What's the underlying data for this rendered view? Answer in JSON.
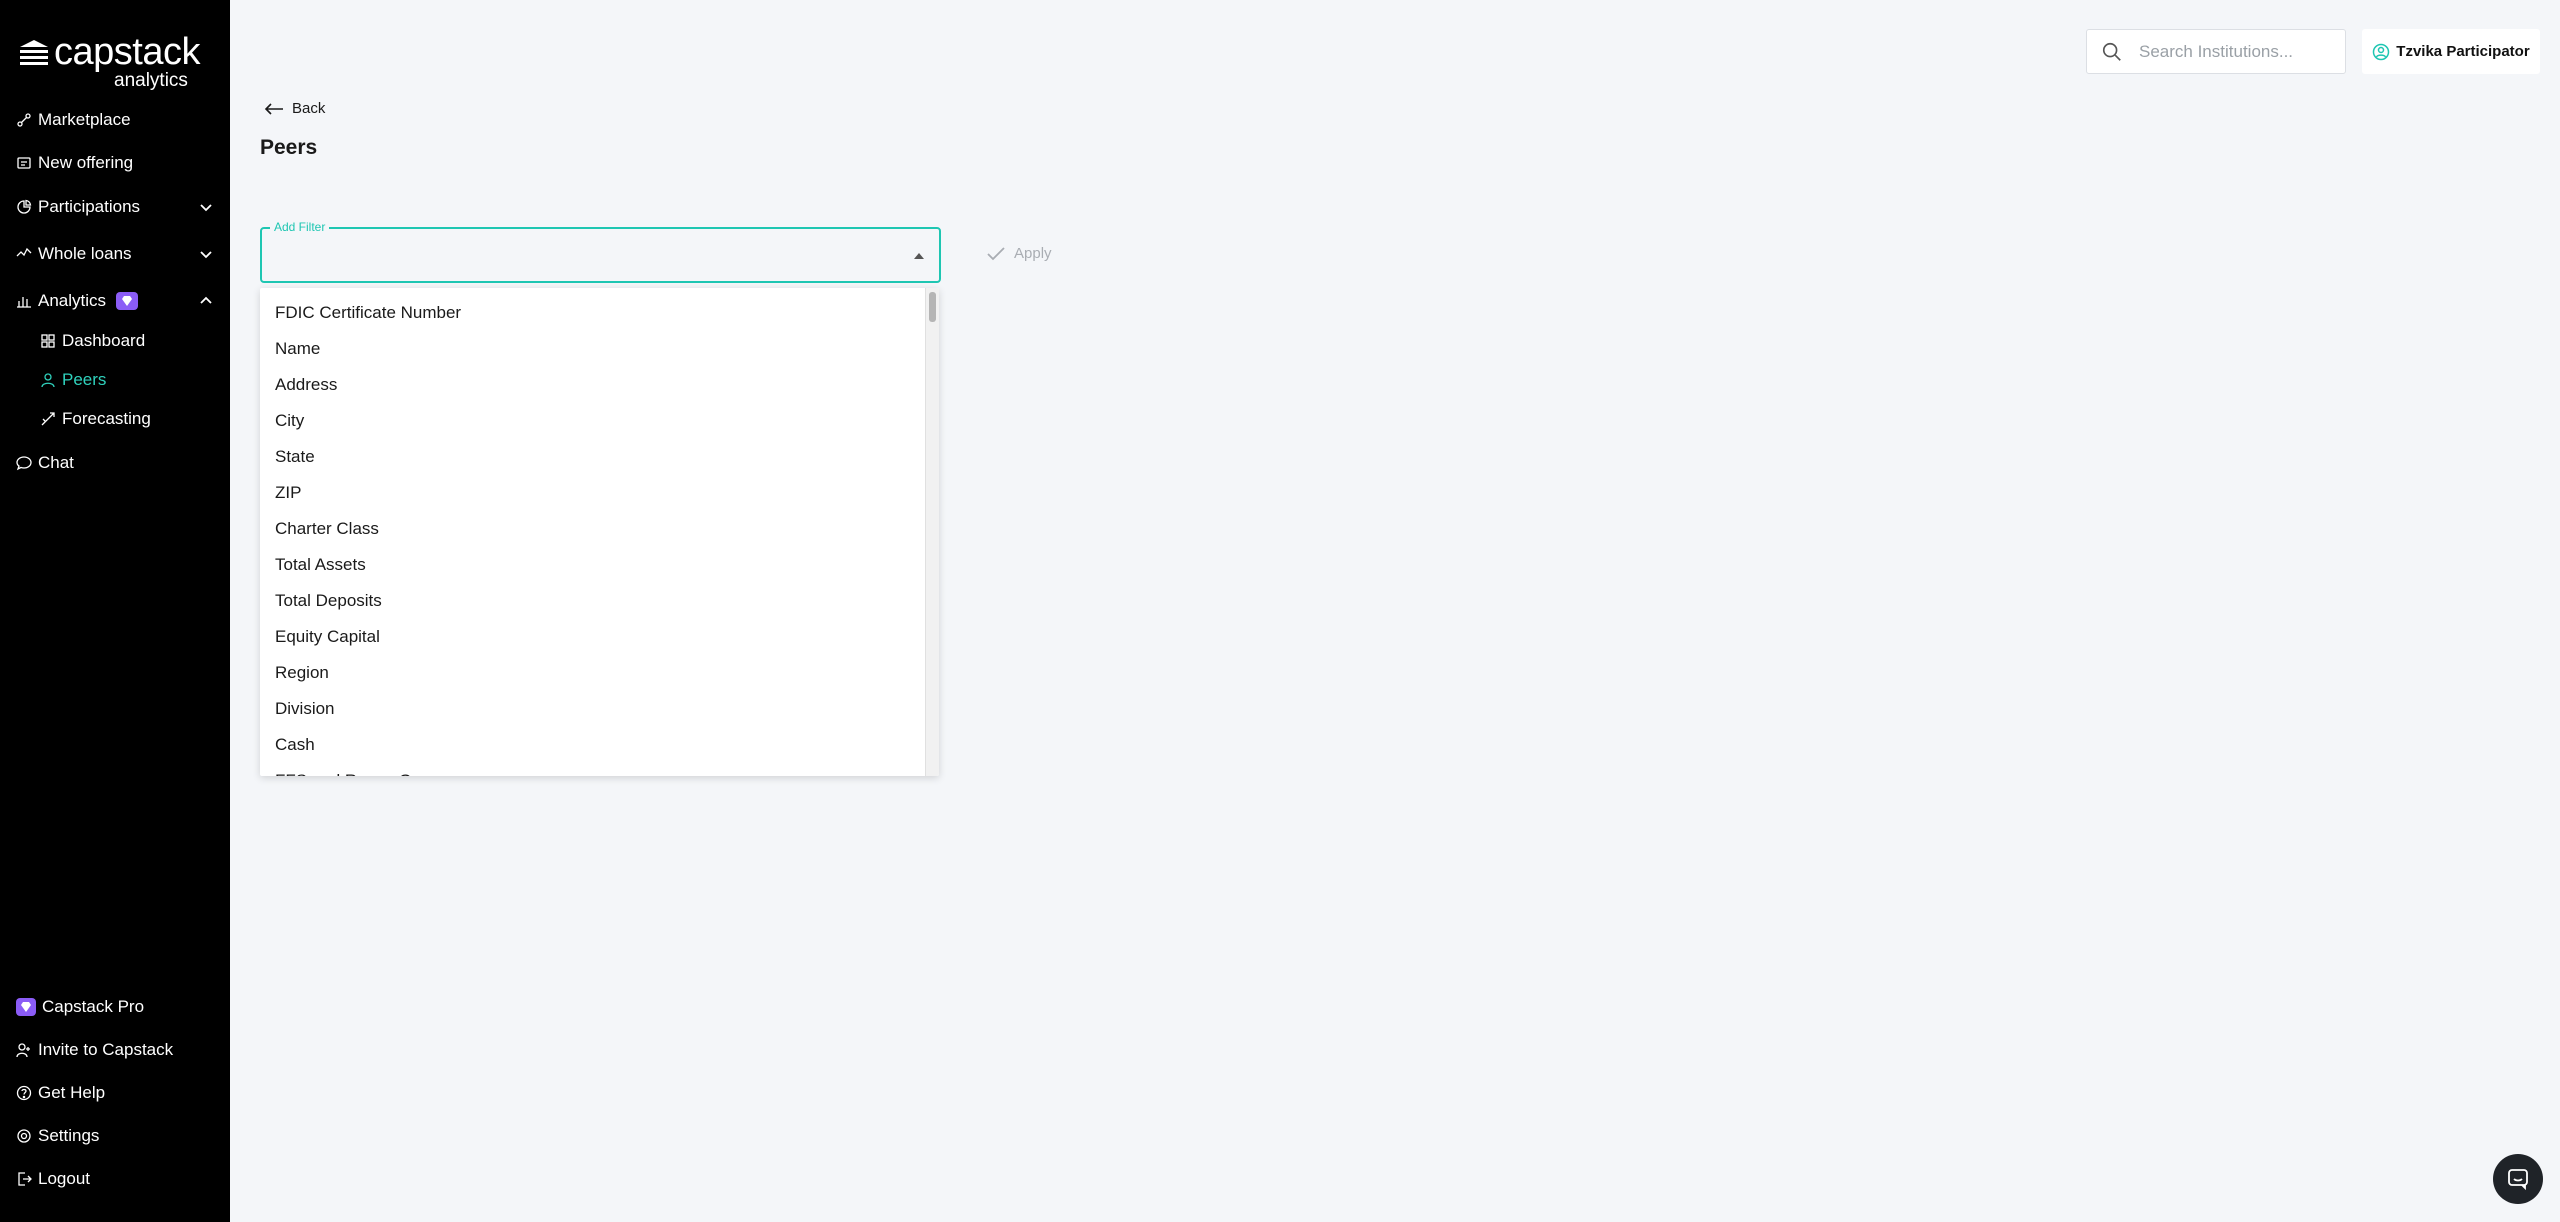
{
  "brand": {
    "name": "capstack",
    "sub": "analytics"
  },
  "nav": {
    "marketplace": "Marketplace",
    "new_offering": "New offering",
    "participations": "Participations",
    "whole_loans": "Whole loans",
    "analytics": "Analytics",
    "dashboard": "Dashboard",
    "peers": "Peers",
    "forecasting": "Forecasting",
    "chat": "Chat"
  },
  "footer": {
    "pro": "Capstack Pro",
    "invite": "Invite to Capstack",
    "help": "Get Help",
    "settings": "Settings",
    "logout": "Logout"
  },
  "topbar": {
    "search_placeholder": "Search Institutions...",
    "user_name": "Tzvika Participator"
  },
  "main": {
    "back_label": "Back",
    "title": "Peers",
    "filter_label": "Add Filter",
    "apply_label": "Apply",
    "filter_options": [
      "FDIC Certificate Number",
      "Name",
      "Address",
      "City",
      "State",
      "ZIP",
      "Charter Class",
      "Total Assets",
      "Total Deposits",
      "Equity Capital",
      "Region",
      "Division",
      "Cash",
      "FFS and Repos Owner"
    ]
  },
  "colors": {
    "accent": "#1ec6b2",
    "active_nav": "#2fd1bc",
    "pro_badge": "#8b5cf6",
    "sidebar_bg": "#000000",
    "page_bg": "#f4f6f9"
  }
}
